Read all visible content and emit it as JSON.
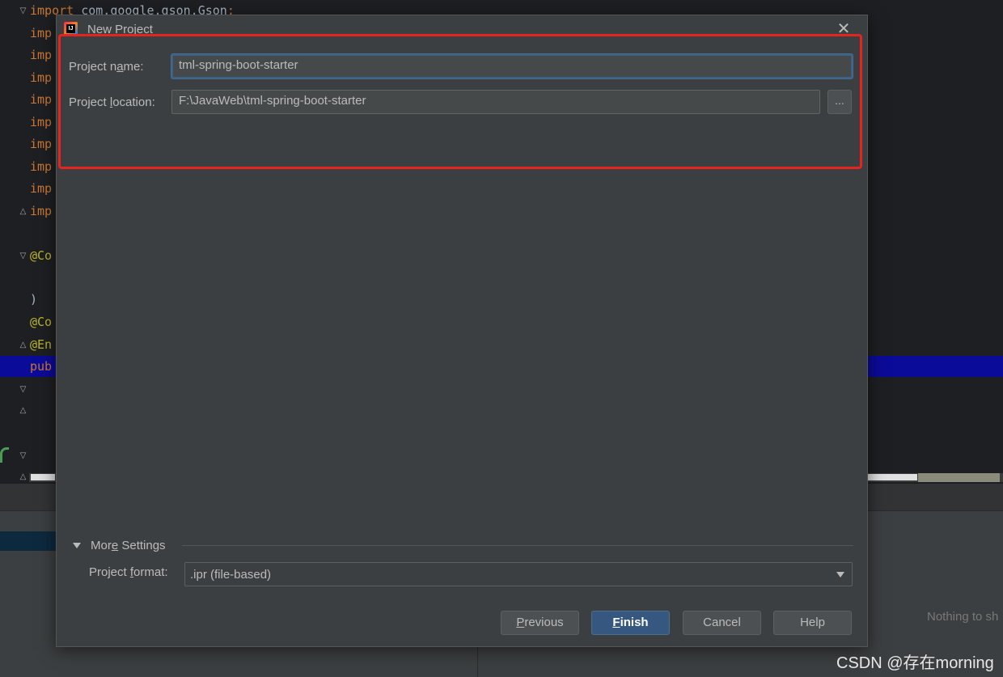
{
  "editor": {
    "lines": [
      {
        "text": "import com.google.gson.Gson;",
        "kind": "keyword"
      },
      {
        "text": "imp",
        "kind": "keyword"
      },
      {
        "text": "imp",
        "kind": "keyword"
      },
      {
        "text": "imp",
        "kind": "keyword"
      },
      {
        "text": "imp",
        "kind": "keyword"
      },
      {
        "text": "imp",
        "kind": "keyword"
      },
      {
        "text": "imp",
        "kind": "keyword"
      },
      {
        "text": "imp",
        "kind": "keyword"
      },
      {
        "text": "imp",
        "kind": "keyword"
      },
      {
        "text": "imp",
        "kind": "keyword"
      },
      {
        "text": "@Co",
        "kind": "annotation"
      },
      {
        "text": ")",
        "kind": "plain"
      },
      {
        "text": "@Co",
        "kind": "annotation"
      },
      {
        "text": "@En",
        "kind": "annotation"
      },
      {
        "text": "pub",
        "kind": "keyword"
      }
    ]
  },
  "dialog": {
    "title": "New Project",
    "project_name": {
      "label_pre": "Project n",
      "label_mnemonic": "a",
      "label_post": "me:",
      "value": "tml-spring-boot-starter"
    },
    "project_location": {
      "label_pre": "Project ",
      "label_mnemonic": "l",
      "label_post": "ocation:",
      "value": "F:\\JavaWeb\\tml-spring-boot-starter",
      "browse_label": "..."
    },
    "more_settings": {
      "label_pre": "Mor",
      "label_mnemonic": "e",
      "label_post": " Settings",
      "project_format_label_pre": "Project ",
      "project_format_label_mnemonic": "f",
      "project_format_label_post": "ormat:",
      "project_format_value": ".ipr (file-based)"
    },
    "buttons": {
      "previous_mnemonic": "P",
      "previous_rest": "revious",
      "finish_mnemonic": "F",
      "finish_rest": "inish",
      "cancel": "Cancel",
      "help": "Help"
    }
  },
  "bottom_panel": {
    "empty_text": "Nothing to sh"
  },
  "watermark": "CSDN @存在morning",
  "colors": {
    "highlight_box": "#e5231f",
    "primary_button": "#365880",
    "selection_bar": "#0b0b99"
  }
}
